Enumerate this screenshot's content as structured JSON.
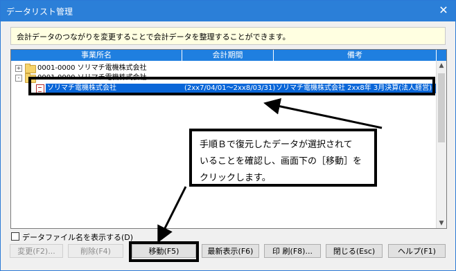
{
  "window": {
    "title": "データリスト管理",
    "close_icon": "close-icon"
  },
  "info": {
    "text": "会計データのつながりを変更することで会計データを整理することができます。"
  },
  "columns": [
    "事業所名",
    "会計期間",
    "備考"
  ],
  "tree": [
    {
      "label": "0001-0000 ソリマチ電機株式会社",
      "expander": "+"
    },
    {
      "label": "0001-0000 ソリマチ電機株式会社",
      "expander": "-"
    }
  ],
  "selected": {
    "name": "ソリマチ電機株式会社",
    "period": "(2xx7/04/01～2xx8/03/31)",
    "note": "ソリマチ電機株式会社 2xx8年 3月決算(法人経営)"
  },
  "callout": {
    "lines": [
      "手順Ｂで復元したデータが選択されて",
      "いることを確認し、画面下の［移動］を",
      "クリックします。"
    ]
  },
  "checkbox": {
    "label": "データファイル名を表示する(D)",
    "checked": false
  },
  "buttons": [
    "変更(F2)...",
    "削除(F4)",
    "移動(F5)",
    "最新表示(F6)",
    "印 刷(F8)...",
    "閉じる(Esc)",
    "ヘルプ(F1)"
  ]
}
